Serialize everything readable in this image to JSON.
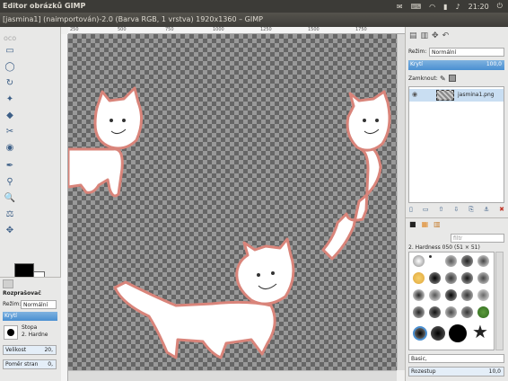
{
  "topbar": {
    "app_title": "Editor obrázků GIMP",
    "clock": "21:20"
  },
  "window": {
    "title": "[jasmina1] (naimportován)-2.0 (Barva RGB, 1 vrstva) 1920x1360 – GIMP"
  },
  "tool_options": {
    "title": "Rozprašovač",
    "mode_label": "Režim:",
    "mode_value": "Normální",
    "opacity_label": "Krytí",
    "brush_label": "Stopa",
    "brush_value": "2. Hardne",
    "size_label": "Velikost",
    "size_value": "20,",
    "ratio_label": "Poměr stran",
    "ratio_value": "0,"
  },
  "layers": {
    "mode_label": "Režim:",
    "mode_value": "Normální",
    "opacity_label": "Krytí",
    "opacity_value": "100,0",
    "lock_label": "Zamknout:",
    "layer_name": "jasmina1.png"
  },
  "brushes": {
    "filter_placeholder": "filtr",
    "title": "2. Hardness 050 (51 × 51)",
    "preset": "Basic,",
    "spacing_label": "Rozestup",
    "spacing_value": "10,0"
  },
  "ruler_ticks": [
    "250",
    "500",
    "750",
    "1000",
    "1250",
    "1500",
    "1750"
  ],
  "colors": {
    "outline": "#d9847a",
    "fill": "#ffffff",
    "accent": "#4a8fd1"
  }
}
